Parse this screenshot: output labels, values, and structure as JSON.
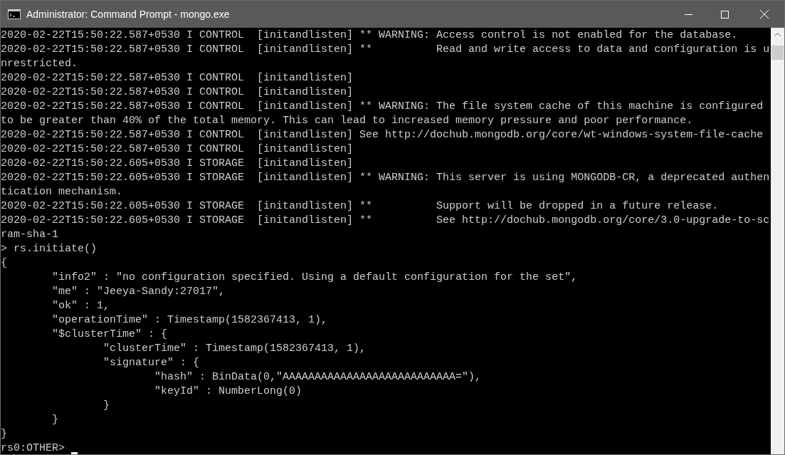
{
  "window": {
    "title": "Administrator: Command Prompt - mongo.exe"
  },
  "console_lines": [
    "2020-02-22T15:50:22.587+0530 I CONTROL  [initandlisten] ** WARNING: Access control is not enabled for the database.",
    "2020-02-22T15:50:22.587+0530 I CONTROL  [initandlisten] **          Read and write access to data and configuration is u",
    "nrestricted.",
    "2020-02-22T15:50:22.587+0530 I CONTROL  [initandlisten]",
    "2020-02-22T15:50:22.587+0530 I CONTROL  [initandlisten]",
    "2020-02-22T15:50:22.587+0530 I CONTROL  [initandlisten] ** WARNING: The file system cache of this machine is configured",
    "to be greater than 40% of the total memory. This can lead to increased memory pressure and poor performance.",
    "2020-02-22T15:50:22.587+0530 I CONTROL  [initandlisten] See http://dochub.mongodb.org/core/wt-windows-system-file-cache",
    "2020-02-22T15:50:22.587+0530 I CONTROL  [initandlisten]",
    "2020-02-22T15:50:22.605+0530 I STORAGE  [initandlisten]",
    "2020-02-22T15:50:22.605+0530 I STORAGE  [initandlisten] ** WARNING: This server is using MONGODB-CR, a deprecated authen",
    "tication mechanism.",
    "2020-02-22T15:50:22.605+0530 I STORAGE  [initandlisten] **          Support will be dropped in a future release.",
    "2020-02-22T15:50:22.605+0530 I STORAGE  [initandlisten] **          See http://dochub.mongodb.org/core/3.0-upgrade-to-sc",
    "ram-sha-1",
    "> rs.initiate()",
    "{",
    "        \"info2\" : \"no configuration specified. Using a default configuration for the set\",",
    "        \"me\" : \"Jeeya-Sandy:27017\",",
    "        \"ok\" : 1,",
    "        \"operationTime\" : Timestamp(1582367413, 1),",
    "        \"$clusterTime\" : {",
    "                \"clusterTime\" : Timestamp(1582367413, 1),",
    "                \"signature\" : {",
    "                        \"hash\" : BinData(0,\"AAAAAAAAAAAAAAAAAAAAAAAAAAA=\"),",
    "                        \"keyId\" : NumberLong(0)",
    "                }",
    "        }",
    "}"
  ],
  "prompt": "rs0:OTHER> "
}
